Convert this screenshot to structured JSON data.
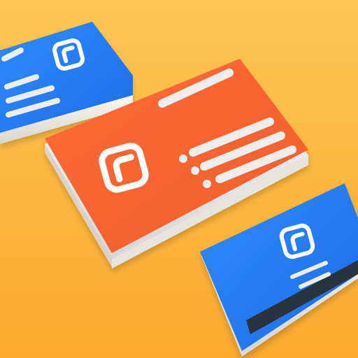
{
  "scene": {
    "subject": "business-card-stacks",
    "cards": [
      {
        "id": "blue-card-top-left",
        "style": "blue",
        "icon": "logo-rounded-square-icon"
      },
      {
        "id": "orange-card-center",
        "style": "orange",
        "icon": "logo-rounded-square-icon"
      },
      {
        "id": "blue-card-bottom-right",
        "style": "blue-with-dark-stripe",
        "icon": "logo-rounded-square-icon"
      }
    ]
  },
  "colors": {
    "background_top": "#FFC552",
    "background_bottom": "#F9A92E",
    "orange_card_light": "#FF6A3A",
    "orange_card_dark": "#F05F2A",
    "blue_card_light": "#2F8CFF",
    "blue_card_dark": "#1E6BE6",
    "paper_edge": "#F1F1F1",
    "paper_edge_shadow": "#D7D7D7",
    "stripe_dark": "#2C3340",
    "mark_white": "#FFFFFF",
    "line_gray": "#EDEDED"
  }
}
